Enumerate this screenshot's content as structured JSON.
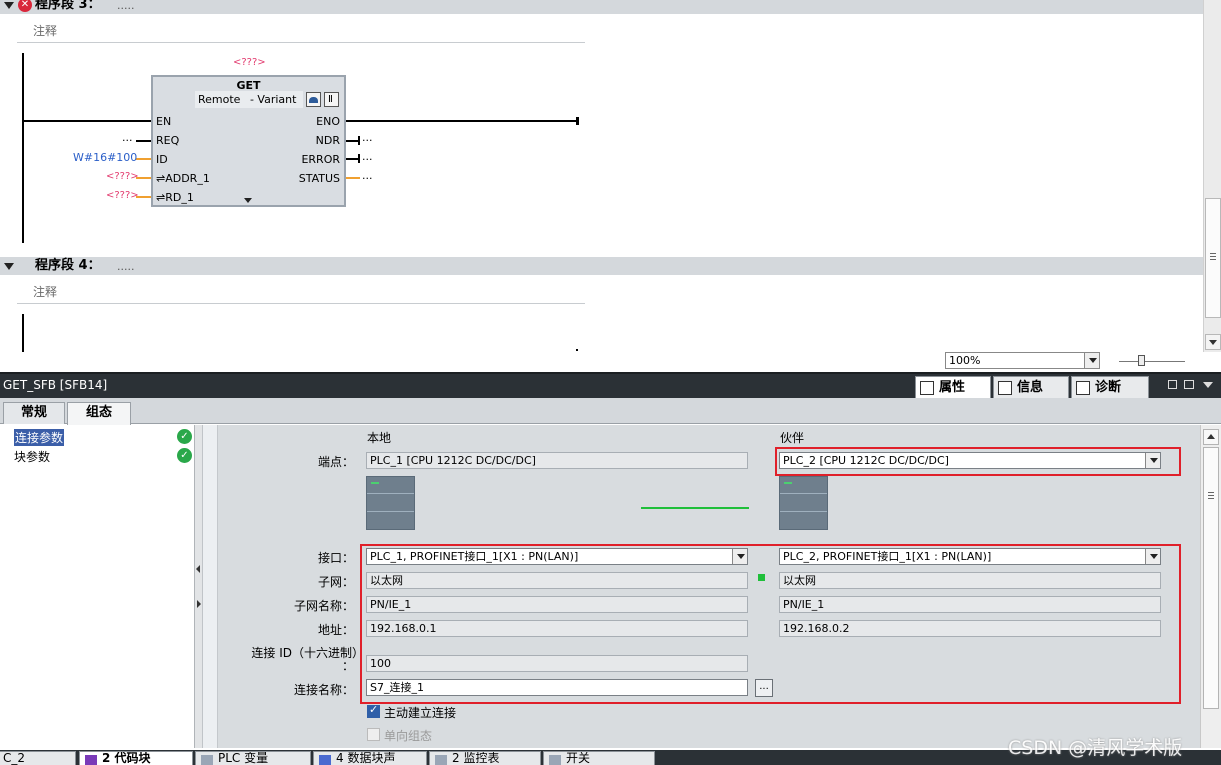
{
  "editor": {
    "networks": [
      {
        "title": "程序段 3：",
        "dots": ".....",
        "comment": "注释"
      },
      {
        "title": "程序段 4：",
        "dots": ".....",
        "comment": "注释"
      }
    ],
    "fb": {
      "instance_placeholder": "<???>",
      "name": "GET",
      "variant_label": "Remote",
      "variant_type": "- Variant",
      "pins_left": [
        "EN",
        "REQ",
        "ID",
        "⇌ADDR_1",
        "⇌RD_1"
      ],
      "pins_right": [
        "ENO",
        "NDR",
        "ERROR",
        "STATUS"
      ],
      "req_value": "...",
      "id_value": "W#16#100",
      "addr_value": "<???>",
      "rd_value": "<???>",
      "ndr_value": "...",
      "error_value": "...",
      "status_value": "..."
    },
    "zoom": "100%"
  },
  "inspector": {
    "title": "GET_SFB [SFB14]",
    "tabs": [
      "属性",
      "信息",
      "诊断"
    ],
    "subtabs": [
      "常规",
      "组态"
    ],
    "nav": [
      {
        "label": "连接参数",
        "status": "ok"
      },
      {
        "label": "块参数",
        "status": "ok"
      }
    ],
    "headers": {
      "local": "本地",
      "partner": "伙伴"
    },
    "labels": {
      "endpoint": "端点：",
      "interface": "接口：",
      "subnet": "子网：",
      "subnet_name": "子网名称：",
      "address": "地址：",
      "conn_id": "连接 ID（十六进制）",
      "conn_id_colon": "：",
      "conn_name": "连接名称："
    },
    "local": {
      "endpoint": "PLC_1 [CPU 1212C DC/DC/DC]",
      "interface": "PLC_1, PROFINET接口_1[X1 : PN(LAN)]",
      "subnet": "以太网",
      "subnet_name": "PN/IE_1",
      "address": "192.168.0.1",
      "conn_id": "100",
      "conn_name": "S7_连接_1"
    },
    "partner": {
      "endpoint": "PLC_2 [CPU 1212C DC/DC/DC]",
      "interface": "PLC_2, PROFINET接口_1[X1 : PN(LAN)]",
      "subnet": "以太网",
      "subnet_name": "PN/IE_1",
      "address": "192.168.0.2"
    },
    "browse_button": "...",
    "checkboxes": [
      {
        "label": "主动建立连接",
        "checked": true,
        "enabled": true
      },
      {
        "label": "单向组态",
        "checked": false,
        "enabled": false
      }
    ],
    "colors": {
      "highlight_border": "#e0202a",
      "ok_green": "#2aa84a",
      "link_green": "#1fbf3a"
    }
  },
  "taskbar": [
    "C_2",
    "2 代码块",
    "PLC 变量",
    "4 数据块声",
    "2 监控表",
    "开关"
  ],
  "watermark": "CSDN @清风学术版"
}
